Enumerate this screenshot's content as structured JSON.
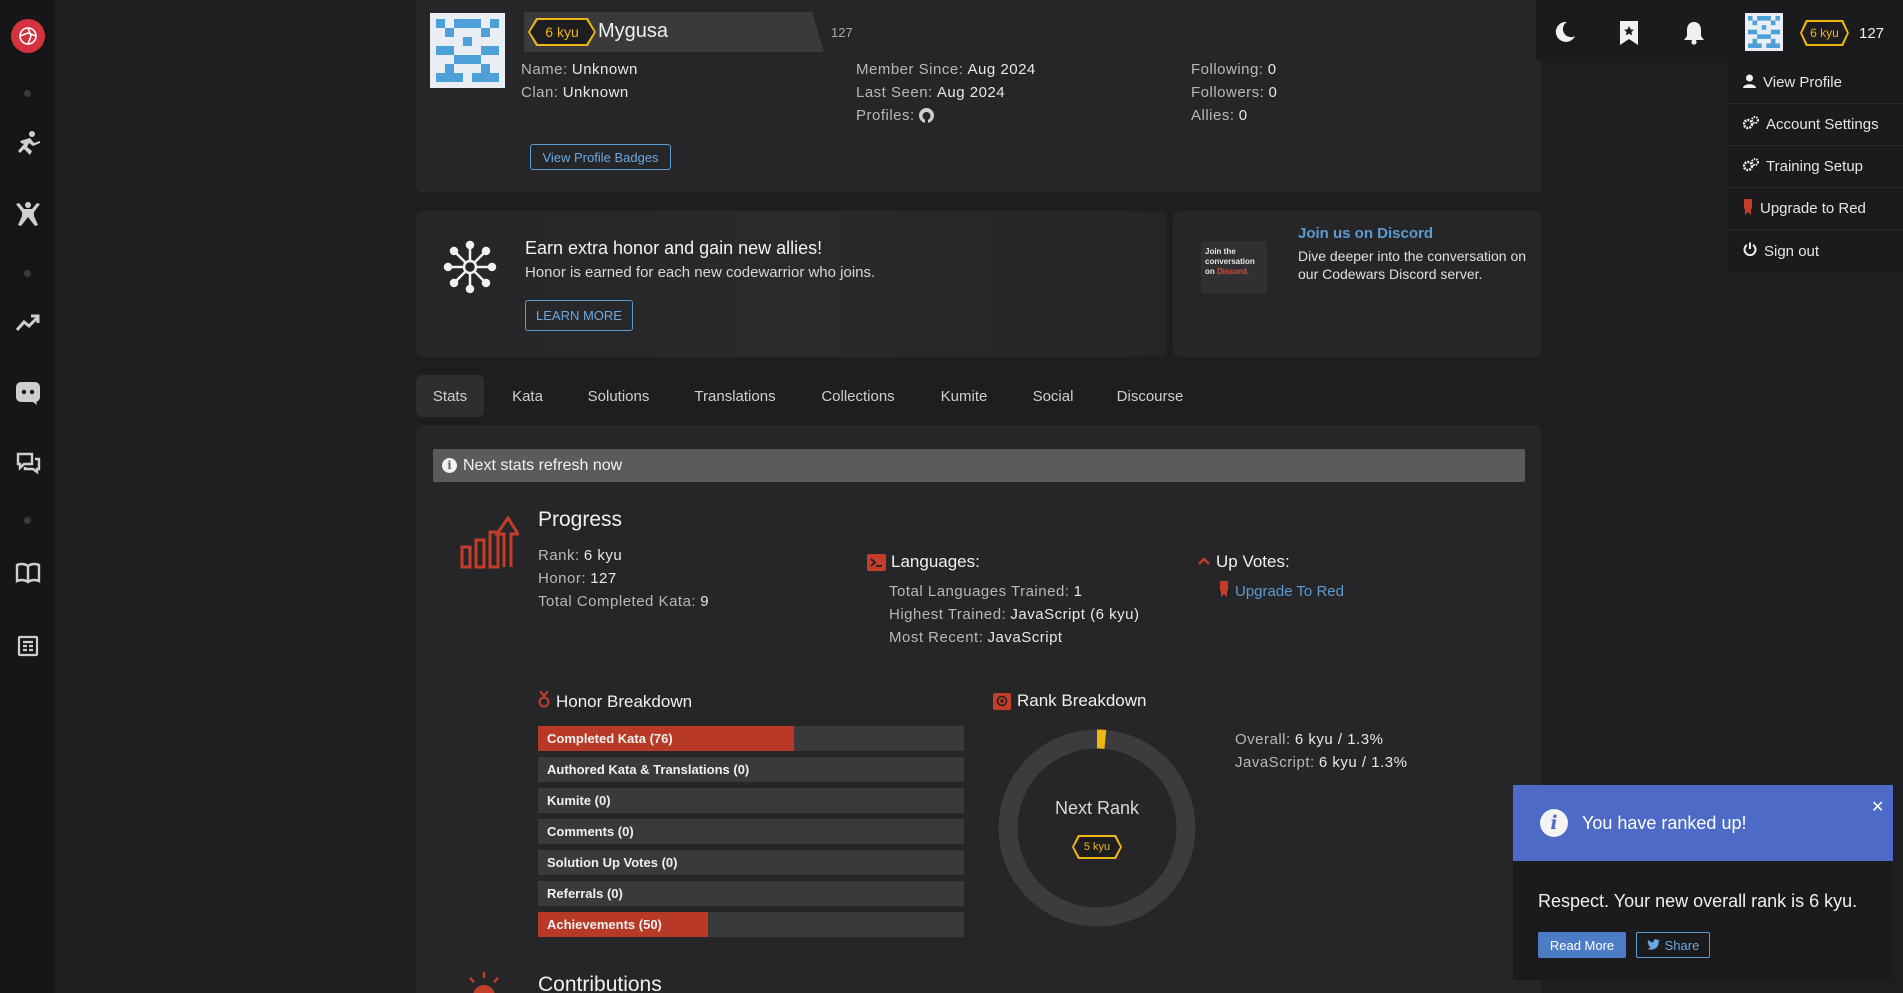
{
  "sidebar": {
    "items": [
      {
        "name": "logo",
        "icon": "codewars-logo"
      },
      {
        "name": "train",
        "icon": "training-icon"
      },
      {
        "name": "practice",
        "icon": "kata-icon"
      },
      {
        "name": "leaderboards",
        "icon": "trending-icon"
      },
      {
        "name": "discord",
        "icon": "discord-icon"
      },
      {
        "name": "forum",
        "icon": "chat-icon"
      },
      {
        "name": "docs",
        "icon": "book-icon"
      },
      {
        "name": "blog",
        "icon": "news-icon"
      }
    ]
  },
  "topbar": {
    "rank": "6 kyu",
    "honor": "127",
    "icons": [
      "moon-icon",
      "bookmark-icon",
      "bell-icon"
    ]
  },
  "user_menu": {
    "items": [
      {
        "label": "View Profile",
        "icon": "user-icon"
      },
      {
        "label": "Account Settings",
        "icon": "gears-icon"
      },
      {
        "label": "Training Setup",
        "icon": "gears-icon"
      },
      {
        "label": "Upgrade to Red",
        "icon": "red-badge-icon"
      },
      {
        "label": "Sign out",
        "icon": "power-icon"
      }
    ]
  },
  "profile": {
    "rank": "6 kyu",
    "username": "Mygusa",
    "honor": "127",
    "name_label": "Name:",
    "name_value": "Unknown",
    "clan_label": "Clan:",
    "clan_value": "Unknown",
    "member_since_label": "Member Since:",
    "member_since_value": "Aug 2024",
    "last_seen_label": "Last Seen:",
    "last_seen_value": "Aug 2024",
    "profiles_label": "Profiles:",
    "following_label": "Following:",
    "following_value": "0",
    "followers_label": "Followers:",
    "followers_value": "0",
    "allies_label": "Allies:",
    "allies_value": "0",
    "badges_button": "View Profile Badges"
  },
  "promo": {
    "title": "Earn extra honor and gain new allies!",
    "text": "Honor is earned for each new codewarrior who joins.",
    "button": "LEARN MORE"
  },
  "discord": {
    "title": "Join us on Discord",
    "text_line1": "Dive deeper into the conversation on",
    "text_line2": "our Codewars Discord server.",
    "thumb_line1": "Join the",
    "thumb_line2": "conversation",
    "thumb_line3": "on",
    "thumb_line3b": "Discord."
  },
  "tabs": [
    "Stats",
    "Kata",
    "Solutions",
    "Translations",
    "Collections",
    "Kumite",
    "Social",
    "Discourse"
  ],
  "stats": {
    "notice": "Next stats refresh now",
    "progress_title": "Progress",
    "rank_label": "Rank:",
    "rank_value": "6 kyu",
    "honor_label": "Honor:",
    "honor_value": "127",
    "completed_label": "Total Completed Kata:",
    "completed_value": "9",
    "languages_title": "Languages:",
    "lang_trained_label": "Total Languages Trained:",
    "lang_trained_value": "1",
    "highest_label": "Highest Trained:",
    "highest_value": "JavaScript (6 kyu)",
    "recent_label": "Most Recent:",
    "recent_value": "JavaScript",
    "upvotes_title": "Up Votes:",
    "upgrade_link": "Upgrade To Red",
    "honor_breakdown_title": "Honor Breakdown",
    "honor_bars": [
      {
        "label": "Completed Kata (76)",
        "value": 76,
        "fill": 0.6
      },
      {
        "label": "Authored Kata & Translations (0)",
        "value": 0,
        "fill": 0
      },
      {
        "label": "Kumite (0)",
        "value": 0,
        "fill": 0
      },
      {
        "label": "Comments (0)",
        "value": 0,
        "fill": 0
      },
      {
        "label": "Solution Up Votes (0)",
        "value": 0,
        "fill": 0
      },
      {
        "label": "Referrals (0)",
        "value": 0,
        "fill": 0
      },
      {
        "label": "Achievements (50)",
        "value": 50,
        "fill": 0.4
      }
    ],
    "rank_breakdown_title": "Rank Breakdown",
    "next_rank_label": "Next Rank",
    "next_rank": "5 kyu",
    "next_rank_progress": 0.013,
    "overall_label": "Overall:",
    "overall_value": "6 kyu / 1.3%",
    "js_label": "JavaScript:",
    "js_value": "6 kyu / 1.3%",
    "contributions_title": "Contributions"
  },
  "toast": {
    "title": "You have ranked up!",
    "message": "Respect. Your new overall rank is 6 kyu.",
    "read_more": "Read More",
    "share": "Share"
  },
  "colors": {
    "accent_red": "#b83a26",
    "rank_yellow": "#ecb613",
    "link_blue": "#6aa8e0",
    "toast_blue": "#4d6ac7"
  }
}
